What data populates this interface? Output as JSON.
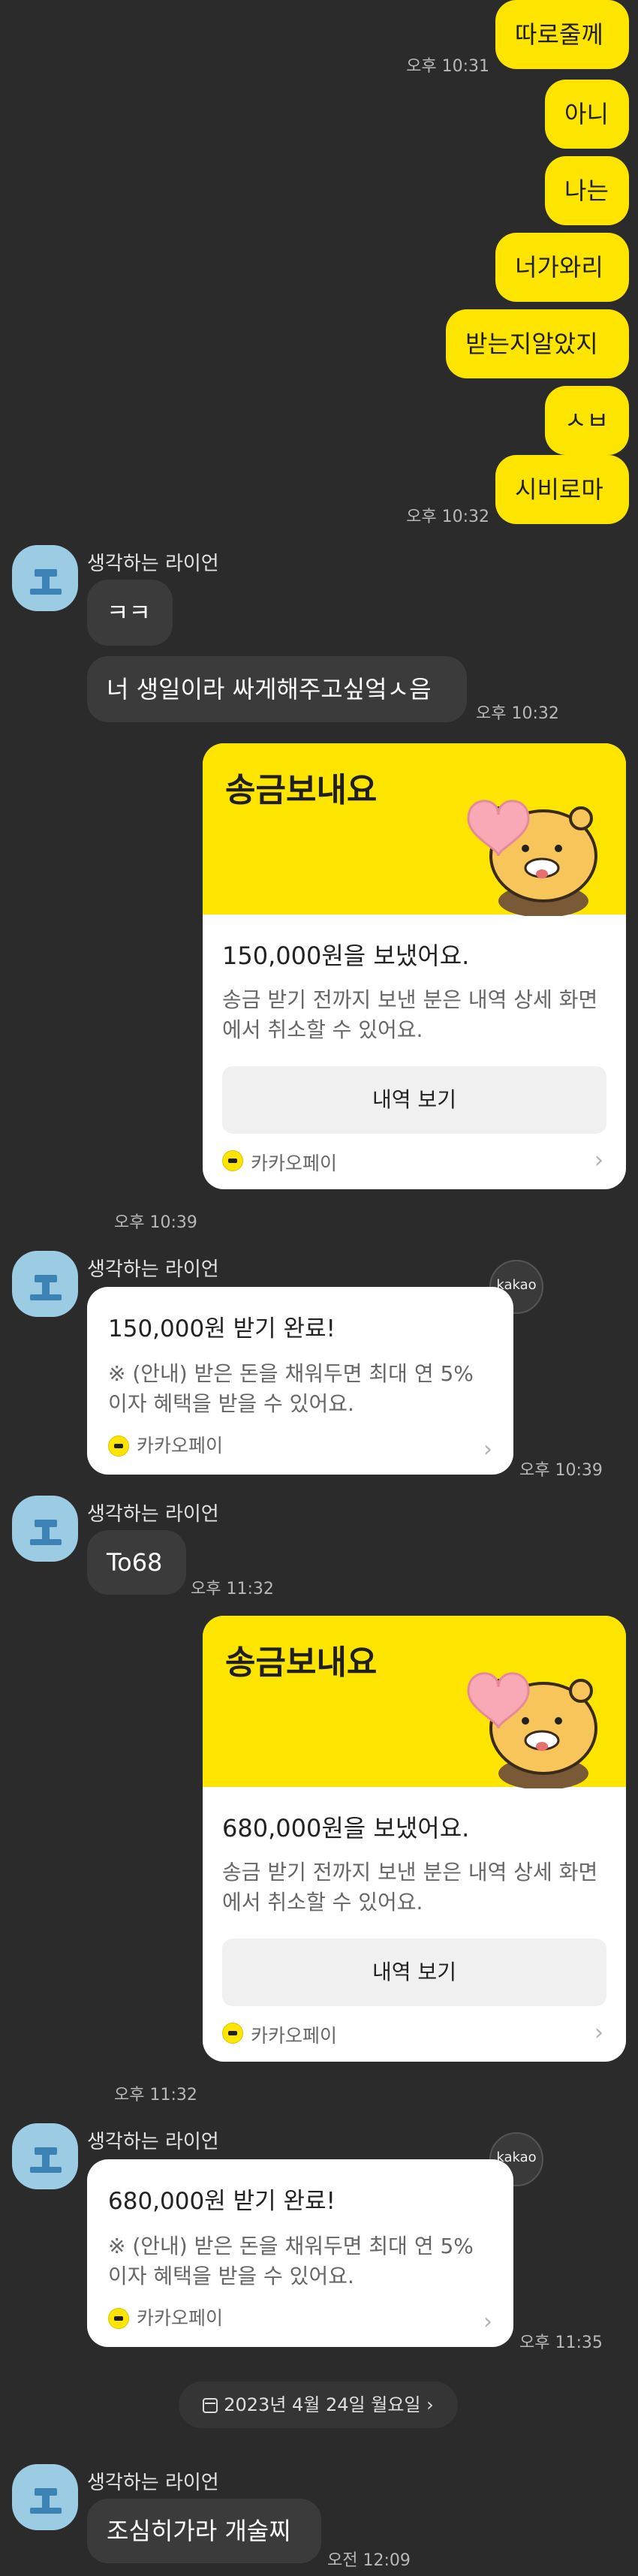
{
  "sent_messages": [
    {
      "text": "따로줄께",
      "time": "오후 10:31"
    },
    {
      "text": "아니",
      "time": ""
    },
    {
      "text": "나는",
      "time": ""
    },
    {
      "text": "너가와리",
      "time": ""
    },
    {
      "text": "받는지알았지",
      "time": ""
    },
    {
      "text": "ㅅㅂ",
      "time": ""
    },
    {
      "text": "시비로마",
      "time": "오후 10:32"
    }
  ],
  "contact": {
    "name": "생각하는 라이언"
  },
  "reply_group_1": {
    "msg1": "ㅋㅋ",
    "msg2": "너 생일이라 싸게해주고싶엌ㅅ음",
    "time": "오후 10:32"
  },
  "transfer_1": {
    "title": "송금보내요",
    "amount": "150,000원을 보냈어요.",
    "desc": "송금 받기 전까지 보낸 분은 내역 상세 화면에서 취소할 수 있어요.",
    "button": "내역 보기",
    "provider": "카카오페이",
    "time": "오후 10:39"
  },
  "receipt_1": {
    "title": "150,000원 받기 완료!",
    "desc": "※ (안내) 받은 돈을 채워두면 최대 연 5% 이자 혜택을 받을 수 있어요.",
    "provider": "카카오페이",
    "badge": "kakao",
    "time": "오후 10:39"
  },
  "reply_group_2": {
    "msg1": "To68",
    "time": "오후 11:32"
  },
  "transfer_2": {
    "title": "송금보내요",
    "amount": "680,000원을 보냈어요.",
    "desc": "송금 받기 전까지 보낸 분은 내역 상세 화면에서 취소할 수 있어요.",
    "button": "내역 보기",
    "provider": "카카오페이",
    "time": "오후 11:32"
  },
  "receipt_2": {
    "title": "680,000원 받기 완료!",
    "desc": "※ (안내) 받은 돈을 채워두면 최대 연 5% 이자 혜택을 받을 수 있어요.",
    "provider": "카카오페이",
    "badge": "kakao",
    "time": "오후 11:35"
  },
  "date_divider": {
    "label": "2023년 4월 24일 월요일",
    "chevron": "›"
  },
  "reply_group_3": {
    "msg1": "조심히가라 개술찌",
    "time": "오전 12:09"
  },
  "colors": {
    "bubble_mine": "#fde500",
    "bubble_theirs": "#3b3b3b",
    "background": "#2b2b2b",
    "avatar": "#9ccbe4"
  }
}
